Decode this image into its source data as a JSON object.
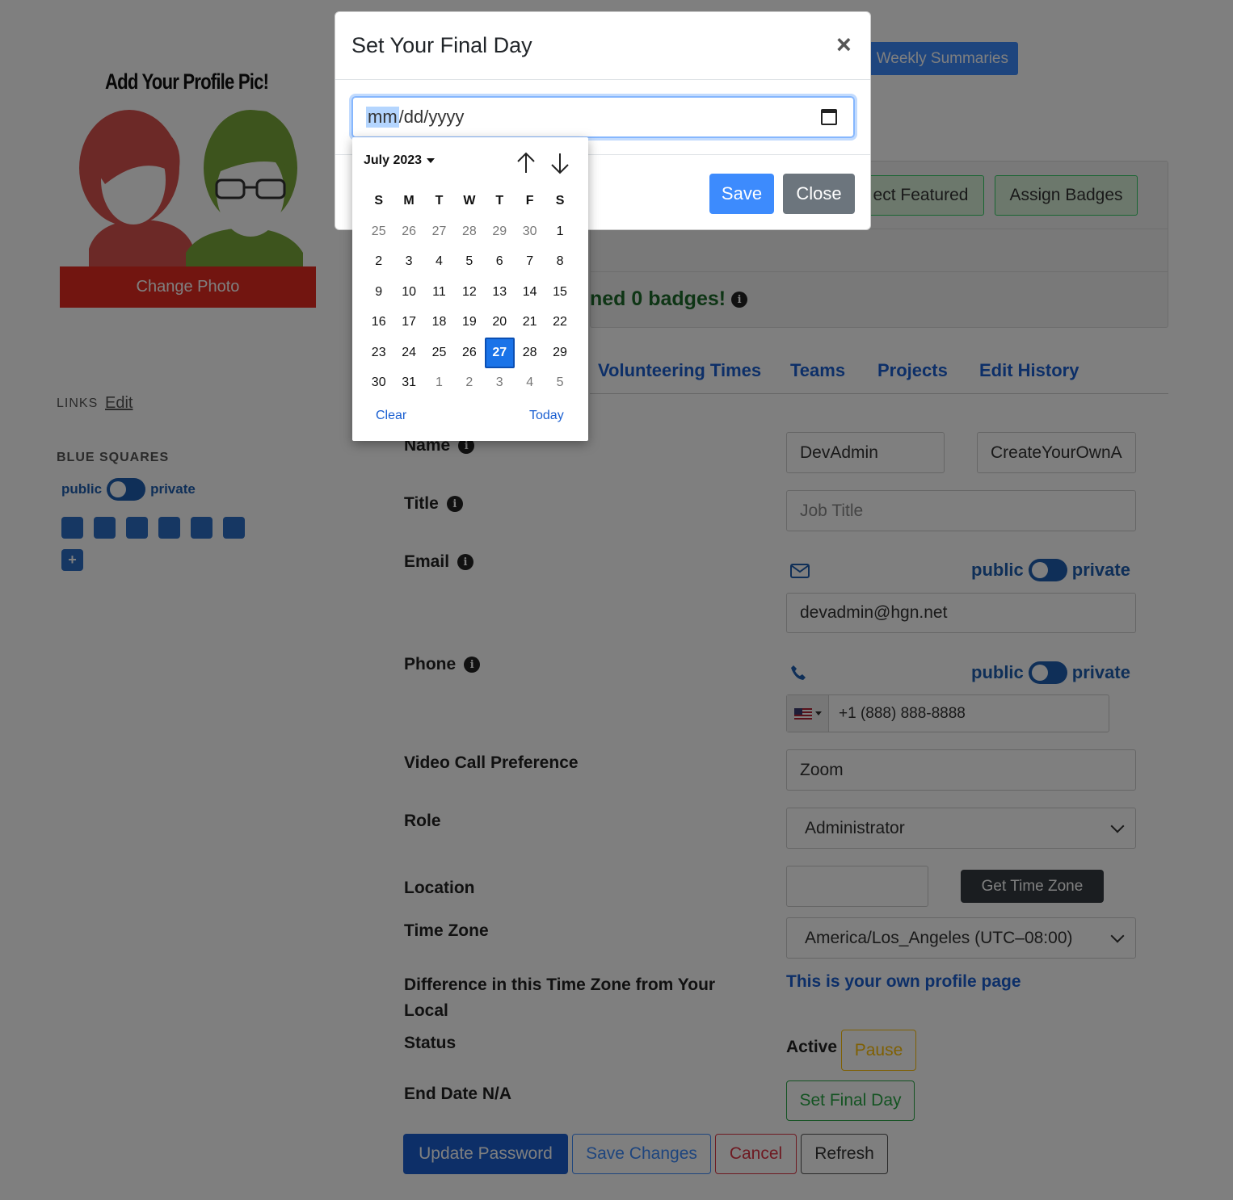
{
  "profile": {
    "pic_heading": "Add Your Profile Pic!",
    "change_photo": "Change Photo",
    "links_label": "LINKS",
    "links_edit": "Edit",
    "blue_squares_label": "BLUE SQUARES",
    "public": "public",
    "private": "private",
    "add_symbol": "+"
  },
  "header": {
    "weekly_summaries": "Weekly Summaries",
    "select_featured": "ect Featured",
    "assign_badges": "Assign Badges",
    "badges_text": "ned 0 badges!"
  },
  "tabs": [
    "Volunteering Times",
    "Teams",
    "Projects",
    "Edit History"
  ],
  "form": {
    "name_label": "Name",
    "first_name": "DevAdmin",
    "last_name": "CreateYourOwnA",
    "title_label": "Title",
    "title_placeholder": "Job Title",
    "email_label": "Email",
    "email_value": "devadmin@hgn.net",
    "phone_label": "Phone",
    "phone_value": "+1 (888) 888-8888",
    "video_label": "Video Call Preference",
    "video_value": "Zoom",
    "role_label": "Role",
    "role_value": "Administrator",
    "location_label": "Location",
    "location_value": "",
    "get_time_zone": "Get Time Zone",
    "timezone_label": "Time Zone",
    "timezone_value": "America/Los_Angeles (UTC–08:00)",
    "difference_label_1": "Difference in this Time Zone from Your",
    "difference_label_2": "Local",
    "own_profile": "This is your own profile page",
    "status_label": "Status",
    "status_value": "Active",
    "pause": "Pause",
    "end_date_label": "End Date N/A",
    "set_final_day": "Set Final Day",
    "public": "public",
    "private": "private"
  },
  "actions": {
    "update_password": "Update Password",
    "save_changes": "Save Changes",
    "cancel": "Cancel",
    "refresh": "Refresh"
  },
  "modal": {
    "title": "Set Your Final Day",
    "close_symbol": "×",
    "date_mm": "mm",
    "date_rest": "/dd/yyyy",
    "save": "Save",
    "close": "Close"
  },
  "calendar": {
    "month_label": "July 2023",
    "weekdays": [
      "S",
      "M",
      "T",
      "W",
      "T",
      "F",
      "S"
    ],
    "days": [
      {
        "d": "25",
        "muted": true
      },
      {
        "d": "26",
        "muted": true
      },
      {
        "d": "27",
        "muted": true
      },
      {
        "d": "28",
        "muted": true
      },
      {
        "d": "29",
        "muted": true
      },
      {
        "d": "30",
        "muted": true
      },
      {
        "d": "1"
      },
      {
        "d": "2"
      },
      {
        "d": "3"
      },
      {
        "d": "4"
      },
      {
        "d": "5"
      },
      {
        "d": "6"
      },
      {
        "d": "7"
      },
      {
        "d": "8"
      },
      {
        "d": "9"
      },
      {
        "d": "10"
      },
      {
        "d": "11"
      },
      {
        "d": "12"
      },
      {
        "d": "13"
      },
      {
        "d": "14"
      },
      {
        "d": "15"
      },
      {
        "d": "16"
      },
      {
        "d": "17"
      },
      {
        "d": "18"
      },
      {
        "d": "19"
      },
      {
        "d": "20"
      },
      {
        "d": "21"
      },
      {
        "d": "22"
      },
      {
        "d": "23"
      },
      {
        "d": "24"
      },
      {
        "d": "25"
      },
      {
        "d": "26"
      },
      {
        "d": "27",
        "selected": true
      },
      {
        "d": "28"
      },
      {
        "d": "29"
      },
      {
        "d": "30"
      },
      {
        "d": "31"
      },
      {
        "d": "1",
        "muted": true
      },
      {
        "d": "2",
        "muted": true
      },
      {
        "d": "3",
        "muted": true
      },
      {
        "d": "4",
        "muted": true
      },
      {
        "d": "5",
        "muted": true
      }
    ],
    "clear": "Clear",
    "today": "Today"
  },
  "colors": {
    "primary": "#3d8bfd",
    "danger": "#e52b20",
    "success": "#1d6b2a",
    "overlay": "rgba(0,0,0,0.5)"
  }
}
